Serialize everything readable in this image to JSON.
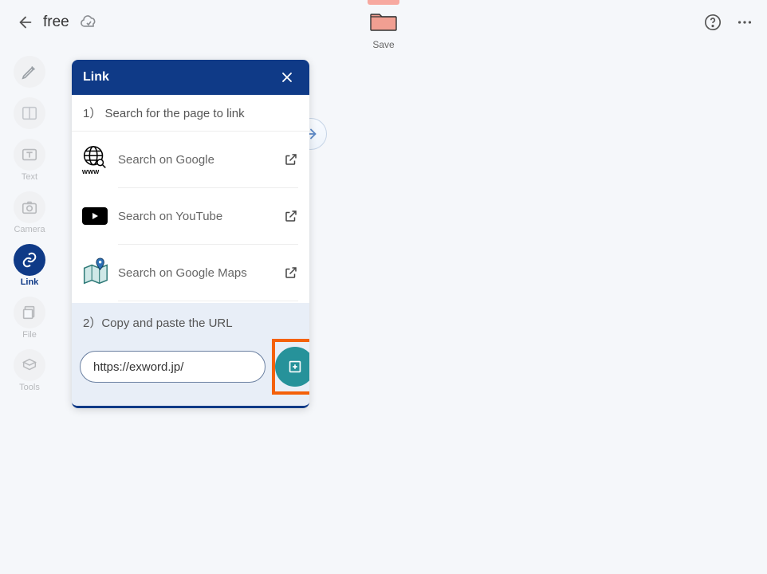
{
  "header": {
    "title": "free",
    "save_label": "Save"
  },
  "sidebar": {
    "items": [
      {
        "label": ""
      },
      {
        "label": ""
      },
      {
        "label": "Text"
      },
      {
        "label": "Camera"
      },
      {
        "label": "Link"
      },
      {
        "label": "File"
      },
      {
        "label": "Tools"
      }
    ]
  },
  "popup": {
    "title": "Link",
    "step1_caption": "1） Search for the page to link",
    "rows": [
      {
        "label": "Search on Google"
      },
      {
        "label": "Search on YouTube"
      },
      {
        "label": "Search on Google Maps"
      }
    ],
    "step2_caption": "2）Copy and paste the URL",
    "url_value": "https://exword.jp/"
  }
}
